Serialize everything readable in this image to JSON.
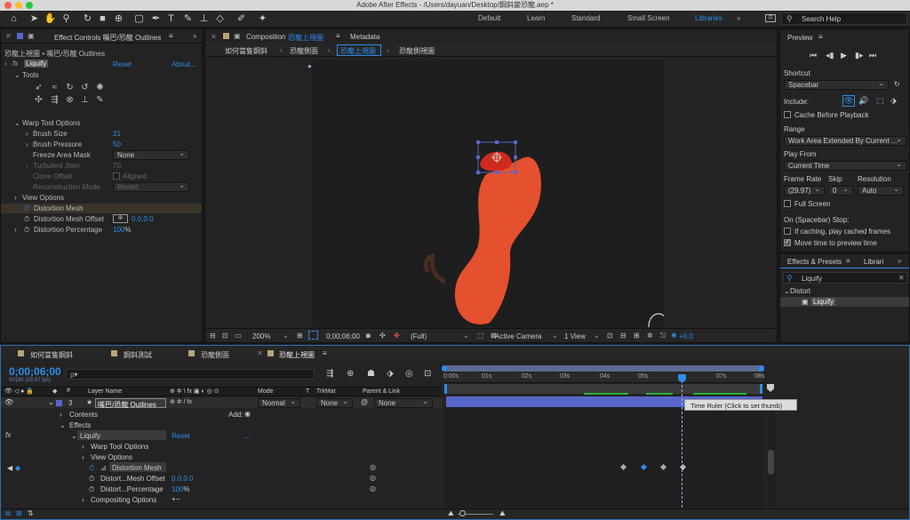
{
  "window": {
    "title": "Adobe After Effects - /Users/dayuan/Desktop/鋼斜變恐龍.aep *"
  },
  "workspaces": [
    "Default",
    "Learn",
    "Standard",
    "Small Screen",
    "Libraries"
  ],
  "search_help": {
    "placeholder": "Search Help"
  },
  "effect_controls": {
    "tab": "Effect Controls 嘴巴/恐龍 Outlines",
    "subtitle": "恐龍上視圖 • 嘴巴/恐龍 Outlines",
    "effect_name": "Liquify",
    "reset": "Reset",
    "about": "About...",
    "tools_label": "Tools",
    "warp_tool_options": "Warp Tool Options",
    "brush_size": {
      "label": "Brush Size",
      "value": "21"
    },
    "brush_pressure": {
      "label": "Brush Pressure",
      "value": "50"
    },
    "freeze_area_mask": {
      "label": "Freeze Area Mask",
      "value": "None"
    },
    "turbulent_jitter": {
      "label": "Turbulent Jitter",
      "value": "70"
    },
    "clone_offset": {
      "label": "Clone Offset",
      "aligned": "Aligned"
    },
    "reconstruction_mode": {
      "label": "Reconstruction Mode",
      "value": "Revert"
    },
    "view_options": "View Options",
    "distortion_mesh": "Distortion Mesh",
    "distortion_mesh_offset": {
      "label": "Distortion Mesh Offset",
      "value": "0.0,0.0"
    },
    "distortion_percentage": {
      "label": "Distortion Percentage",
      "value": "100",
      "unit": "%"
    }
  },
  "composition": {
    "tab": "Composition",
    "tab_name": "恐龍上視圖",
    "metadata": "Metadata",
    "breadcrumbs": [
      "如何當隻鋼斜",
      "恐龍側面",
      "恐龍上視圖",
      "恐龍側視圖"
    ],
    "zoom": "200%",
    "timecode": "0;00;06;00",
    "resolution": "(Full)",
    "camera": "Active Camera",
    "view": "1 View",
    "exposure": "+0.0"
  },
  "preview": {
    "title": "Preview",
    "shortcut_label": "Shortcut",
    "shortcut": "Spacebar",
    "include_label": "Include:",
    "cache_before_playback": "Cache Before Playback",
    "range_label": "Range",
    "range": "Work Area Extended By Current ...",
    "play_from_label": "Play From",
    "play_from": "Current Time",
    "frame_rate_label": "Frame Rate",
    "skip_label": "Skip",
    "resolution_label": "Resolution",
    "frame_rate": "(29.97)",
    "skip": "0",
    "resolution": "Auto",
    "full_screen": "Full Screen",
    "spacebar_stop": "On (Spacebar) Stop:",
    "if_caching": "If caching, play cached frames",
    "move_time": "Move time to preview time"
  },
  "effects_presets": {
    "tab": "Effects & Presets",
    "tab2": "Librari",
    "search": "Liquify",
    "category": "Distort",
    "item": "Liquify"
  },
  "timeline": {
    "tabs": [
      "如何當隻鋼斜",
      "鋼斜測試",
      "恐龍側面",
      "恐龍上視圖"
    ],
    "timecode": "0;00;06;00",
    "fps": "00180 (29.97 fps)",
    "search_placeholder": "ρ▾",
    "col_num": "#",
    "col_layer": "Layer Name",
    "col_switches": "⊕ ✲ \\ fx ▣ ◐ ◎ ⊙",
    "col_mode": "Mode",
    "col_t": "T",
    "col_trkmat": "TrkMat",
    "col_parent": "Parent & Link",
    "layer": {
      "num": "3",
      "name": "嘴巴/恐龍 Outlines",
      "mode": "Normal",
      "trkmat": "None",
      "parent": "None"
    },
    "contents": "Contents",
    "add": "Add:",
    "effects": "Effects",
    "liquify": "Liquify",
    "reset": "Reset",
    "dots": "...",
    "warp_tool_options": "Warp Tool Options",
    "view_options": "View Options",
    "distortion_mesh": "Distortion Mesh",
    "mesh_offset": {
      "label": "Distort...Mesh Offset",
      "value": "0.0,0.0"
    },
    "percentage": {
      "label": "Distort...Percentage",
      "value": "100",
      "unit": "%"
    },
    "compositing_options": "Compositing Options",
    "compositing_add": "+−",
    "ruler": [
      "0:00s",
      "01s",
      "02s",
      "03s",
      "04s",
      "05s",
      "",
      "07s",
      "08s"
    ],
    "tooltip": "Time Ruler (Click to set thumb)"
  },
  "colors": {
    "accent": "#2d8ceb",
    "creature": "#e5502e",
    "layer_bar": "#5866c9",
    "label_blue": "#5866c9"
  }
}
